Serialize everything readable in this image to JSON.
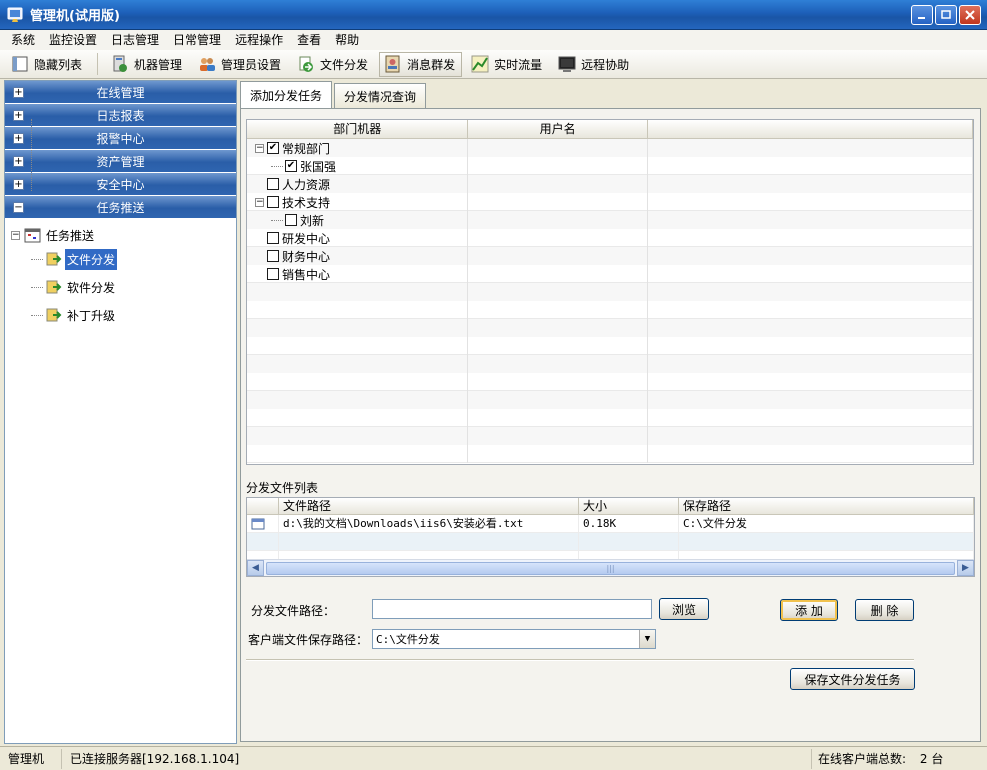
{
  "window": {
    "title": "管理机(试用版)"
  },
  "menu": [
    "系统",
    "监控设置",
    "日志管理",
    "日常管理",
    "远程操作",
    "查看",
    "帮助"
  ],
  "toolbar": {
    "hide_list": "隐藏列表",
    "machine_mgmt": "机器管理",
    "admin_settings": "管理员设置",
    "file_dist": "文件分发",
    "msg_broadcast": "消息群发",
    "realtime_traffic": "实时流量",
    "remote_assist": "远程协助"
  },
  "sidebar": {
    "sections": [
      "在线管理",
      "日志报表",
      "报警中心",
      "资产管理",
      "安全中心",
      "任务推送"
    ],
    "tree_root": "任务推送",
    "tree_items": [
      "文件分发",
      "软件分发",
      "补丁升级"
    ]
  },
  "tabs": [
    "添加分发任务",
    "分发情况查询"
  ],
  "machine_grid": {
    "headers": [
      "部门机器",
      "用户名",
      ""
    ],
    "rows": [
      {
        "label": "常规部门",
        "checked": true,
        "level": 0,
        "expandable": true
      },
      {
        "label": "张国强",
        "checked": true,
        "level": 1,
        "expandable": false
      },
      {
        "label": "人力资源",
        "checked": false,
        "level": 0,
        "expandable": false
      },
      {
        "label": "技术支持",
        "checked": false,
        "level": 0,
        "expandable": true
      },
      {
        "label": "刘新",
        "checked": false,
        "level": 1,
        "expandable": false
      },
      {
        "label": "研发中心",
        "checked": false,
        "level": 0,
        "expandable": false
      },
      {
        "label": "财务中心",
        "checked": false,
        "level": 0,
        "expandable": false
      },
      {
        "label": "销售中心",
        "checked": false,
        "level": 0,
        "expandable": false
      }
    ]
  },
  "file_list": {
    "title": "分发文件列表",
    "headers": [
      "文件路径",
      "大小",
      "保存路径"
    ],
    "rows": [
      {
        "path": "d:\\我的文档\\Downloads\\iis6\\安装必看.txt",
        "size": "0.18K",
        "save_path": "C:\\文件分发"
      }
    ]
  },
  "form": {
    "file_path_label": "分发文件路径：",
    "file_path_value": "",
    "browse_label": "浏览",
    "add_label": "添 加",
    "delete_label": "删 除",
    "client_path_label": "客户端文件保存路径：",
    "client_path_value": "C:\\文件分发",
    "save_task_label": "保存文件分发任务"
  },
  "status": {
    "app": "管理机",
    "connection": "已连接服务器[192.168.1.104]",
    "online_label": "在线客户端总数:",
    "online_count": "2 台"
  }
}
